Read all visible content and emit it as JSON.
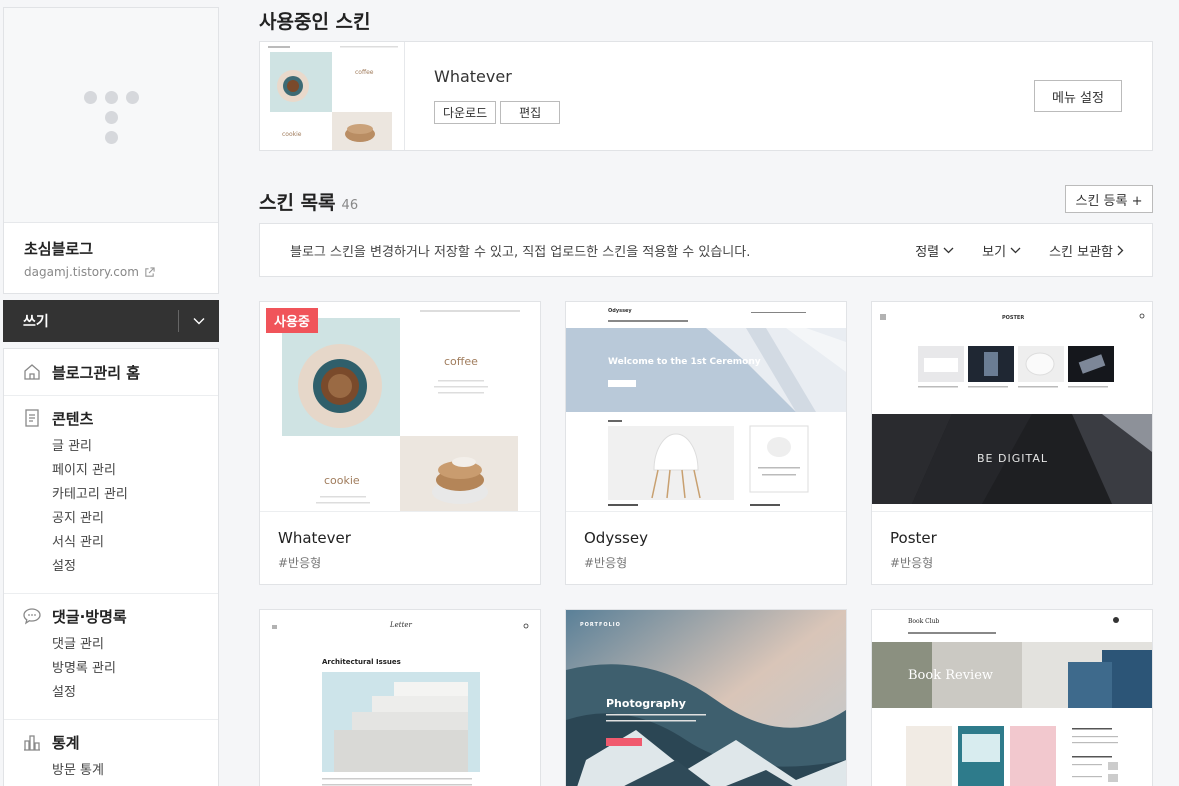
{
  "sidebar": {
    "blog_name": "초심블로그",
    "blog_url": "dagamj.tistory.com",
    "write_label": "쓰기",
    "menu": {
      "home": "블로그관리 홈",
      "contents": {
        "title": "콘텐츠",
        "items": [
          "글 관리",
          "페이지 관리",
          "카테고리 관리",
          "공지 관리",
          "서식 관리",
          "설정"
        ]
      },
      "comments": {
        "title": "댓글·방명록",
        "items": [
          "댓글 관리",
          "방명록 관리",
          "설정"
        ]
      },
      "stats": {
        "title": "통계",
        "items": [
          "방문 통계"
        ]
      }
    }
  },
  "current": {
    "section_title": "사용중인 스킨",
    "name": "Whatever",
    "download_label": "다운로드",
    "edit_label": "편집",
    "menu_setting_label": "메뉴 설정",
    "thumb": {
      "top_text": "coffee",
      "bottom_text": "cookie"
    }
  },
  "list": {
    "title": "스킨 목록",
    "count": "46",
    "register_label": "스킨 등록 +",
    "info_text": "블로그 스킨을 변경하거나 저장할 수 있고, 직접 업로드한 스킨을 적용할 수 있습니다.",
    "sort_label": "정렬",
    "view_label": "보기",
    "archive_label": "스킨 보관함"
  },
  "skins": [
    {
      "name": "Whatever",
      "tag": "#반응형",
      "badge": "사용중",
      "thumb_text": [
        "coffee",
        "cookie"
      ]
    },
    {
      "name": "Odyssey",
      "tag": "#반응형",
      "thumb_text": [
        "Odyssey",
        "Welcome to the 1st Ceremony"
      ]
    },
    {
      "name": "Poster",
      "tag": "#반응형",
      "thumb_text": [
        "POSTER",
        "BE DIGITAL"
      ]
    },
    {
      "name": "",
      "tag": "",
      "thumb_text": [
        "Letter",
        "Architectural Issues"
      ]
    },
    {
      "name": "",
      "tag": "",
      "thumb_text": [
        "PORTFOLIO",
        "Photography"
      ]
    },
    {
      "name": "",
      "tag": "",
      "thumb_text": [
        "Book Club",
        "Book Review"
      ]
    }
  ],
  "colors": {
    "badge": "#f0545a",
    "dark_bar": "#333333",
    "border": "#e1e3e6",
    "background": "#f5f6f8"
  }
}
